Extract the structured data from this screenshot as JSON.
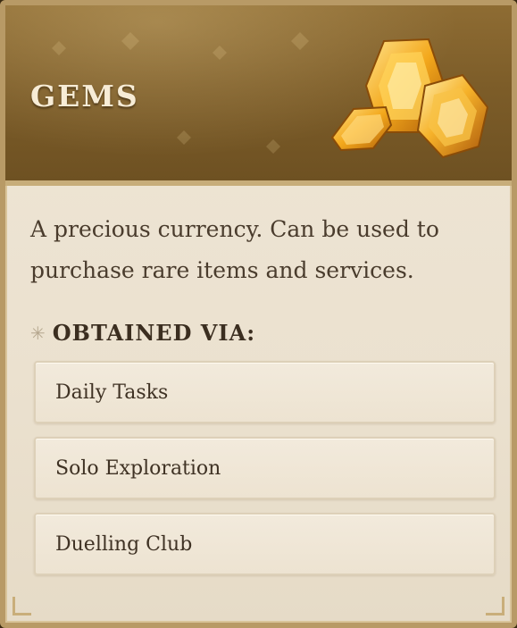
{
  "item": {
    "title": "GEMS",
    "icon": "gems-icon",
    "description": "A precious currency. Can be used to purchase rare items and services."
  },
  "obtained": {
    "heading": "OBTAINED VIA:",
    "bullet_icon": "star-icon",
    "sources": [
      {
        "label": "Daily Tasks"
      },
      {
        "label": "Solo Exploration"
      },
      {
        "label": "Duelling Club"
      }
    ]
  },
  "colors": {
    "header": "#7d5d29",
    "panel": "#ebe1cf",
    "title_text": "#f7ecd6",
    "gem_gold": "#f0a91e"
  }
}
